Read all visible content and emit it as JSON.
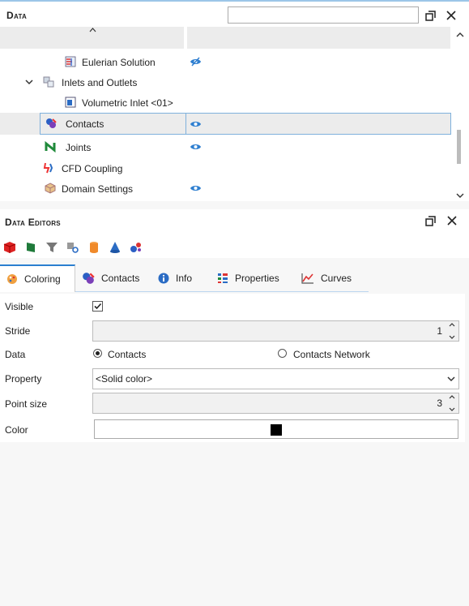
{
  "data_panel": {
    "title": "Data",
    "search_placeholder": "",
    "rows": [
      {
        "label": "Eulerian Solution",
        "icon": "eulerian-icon",
        "visible_state": "eye-hidden"
      },
      {
        "label": "Inlets and Outlets",
        "icon": "inlets-outlets-icon",
        "visible_state": "none"
      },
      {
        "label": "Volumetric Inlet <01>",
        "icon": "volumetric-inlet-icon",
        "visible_state": "none"
      },
      {
        "label": "Contacts",
        "icon": "contacts-icon",
        "visible_state": "eye-visible"
      },
      {
        "label": "Joints",
        "icon": "joints-icon",
        "visible_state": "eye-visible"
      },
      {
        "label": "CFD Coupling",
        "icon": "cfd-coupling-icon",
        "visible_state": "none"
      },
      {
        "label": "Domain Settings",
        "icon": "domain-settings-icon",
        "visible_state": "eye-visible"
      }
    ]
  },
  "editors": {
    "title": "Data Editors",
    "tabs": [
      {
        "label": "Coloring",
        "icon": "palette-icon"
      },
      {
        "label": "Contacts",
        "icon": "contacts-icon"
      },
      {
        "label": "Info",
        "icon": "info-icon"
      },
      {
        "label": "Properties",
        "icon": "properties-icon"
      },
      {
        "label": "Curves",
        "icon": "curves-icon"
      }
    ],
    "active_tab": "Coloring",
    "form": {
      "visible_label": "Visible",
      "visible_checked": true,
      "stride_label": "Stride",
      "stride_value": "1",
      "data_label": "Data",
      "data_options": [
        "Contacts",
        "Contacts Network"
      ],
      "data_selected": "Contacts",
      "property_label": "Property",
      "property_value": "<Solid color>",
      "point_size_label": "Point size",
      "point_size_value": "3",
      "color_label": "Color",
      "color_value": "#000000"
    }
  },
  "colors": {
    "accent": "#2b7fd0",
    "eye": "#2f7fd0",
    "selection_border": "#7fb1dc"
  }
}
